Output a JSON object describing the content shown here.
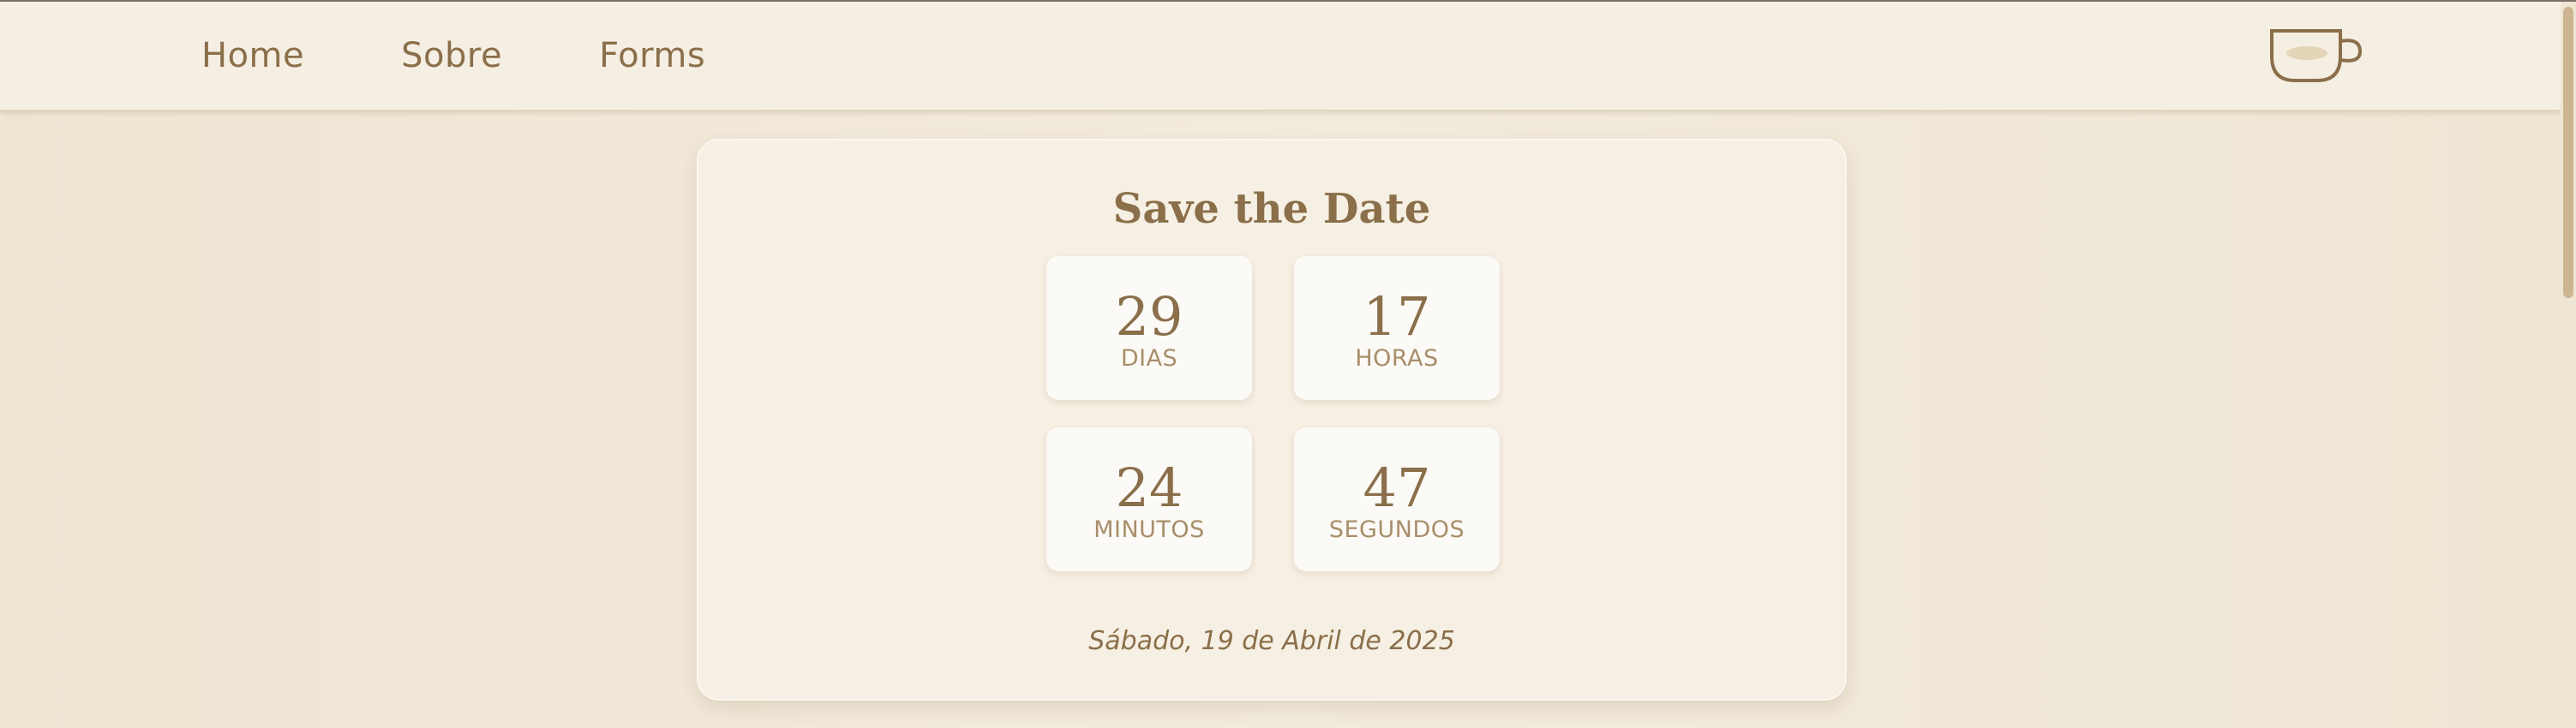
{
  "nav": {
    "links": [
      {
        "label": "Home"
      },
      {
        "label": "Sobre"
      },
      {
        "label": "Forms"
      }
    ],
    "logo_icon": "coffee-cup-icon"
  },
  "countdown": {
    "title": "Save the Date",
    "units": [
      {
        "value": "29",
        "label": "DIAS"
      },
      {
        "value": "17",
        "label": "HORAS"
      },
      {
        "value": "24",
        "label": "MINUTOS"
      },
      {
        "value": "47",
        "label": "SEGUNDOS"
      }
    ],
    "date_text": "Sábado, 19 de Abril de 2025"
  },
  "colors": {
    "accent": "#8a6f4a",
    "label": "#a88e6a",
    "background": "#f1e8d8",
    "card": "#f6efe3",
    "tile": "#fcfaf6"
  }
}
